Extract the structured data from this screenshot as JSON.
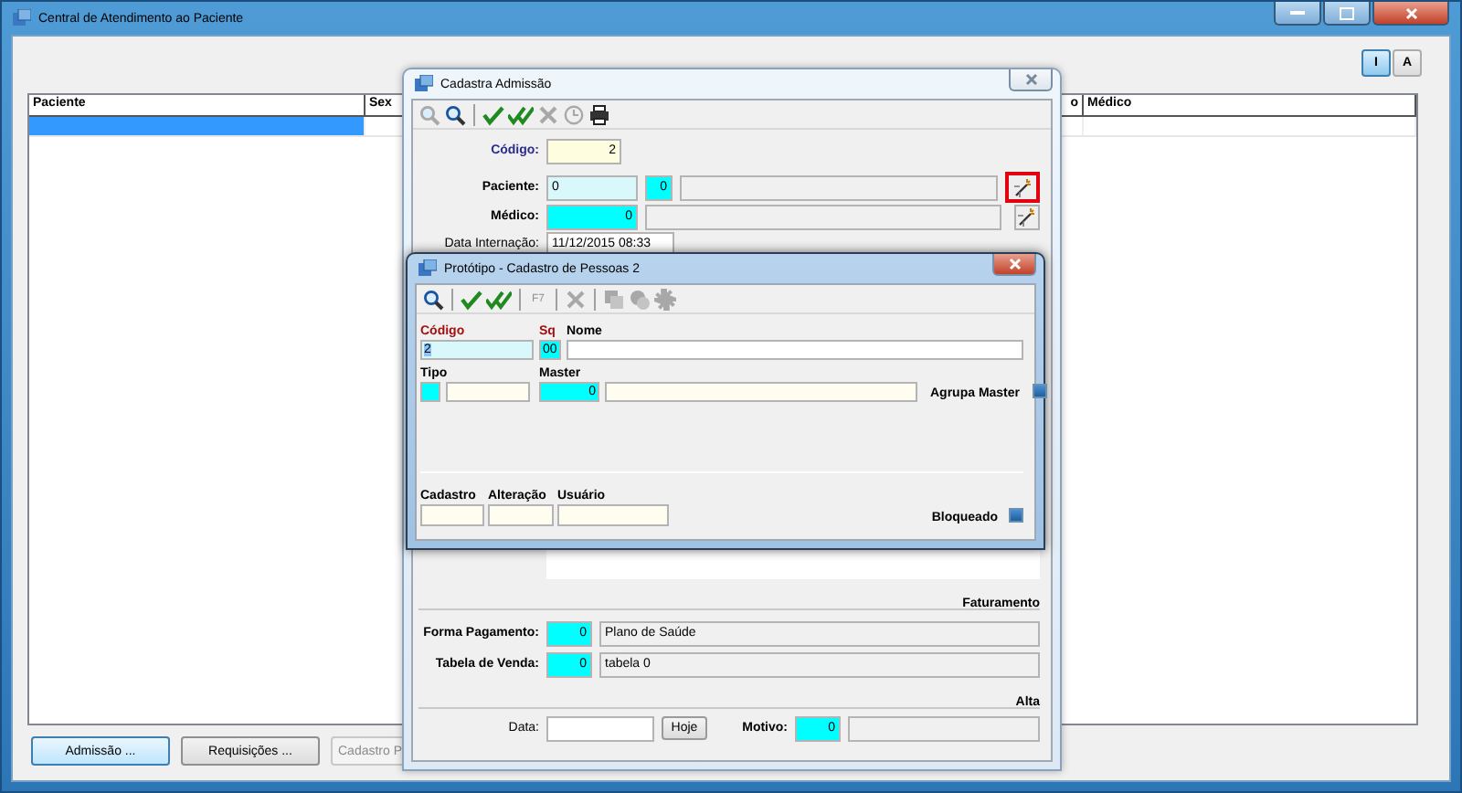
{
  "window": {
    "title": "Central de Atendimento ao Paciente"
  },
  "view_toggle": [
    {
      "label": "I",
      "selected": true
    },
    {
      "label": "A",
      "selected": false
    }
  ],
  "table": {
    "columns": [
      "Paciente",
      "Sex",
      "o",
      "Médico"
    ],
    "rows": [
      {
        "selected": true
      }
    ]
  },
  "buttons": [
    {
      "label": "Admissão ...",
      "focused": true,
      "disabled": false
    },
    {
      "label": "Requisições ...",
      "focused": false,
      "disabled": false
    },
    {
      "label": "Cadastro P",
      "focused": false,
      "disabled": true
    }
  ],
  "admission_dialog": {
    "title": "Cadastra Admissão",
    "toolbar": [
      {
        "kind": "zoom",
        "disabled": true
      },
      {
        "kind": "search",
        "disabled": false
      },
      {
        "kind": "separator"
      },
      {
        "kind": "check",
        "disabled": false
      },
      {
        "kind": "check-all",
        "disabled": false
      },
      {
        "kind": "cancel",
        "disabled": true
      },
      {
        "kind": "history",
        "disabled": true
      },
      {
        "kind": "print",
        "disabled": false
      }
    ],
    "codigo": {
      "label": "Código:",
      "value": "2",
      "emphasis": true
    },
    "paciente": {
      "label": "Paciente:",
      "value": "0",
      "code": "0",
      "lookup_highlighted": true
    },
    "medico": {
      "label": "Médico:",
      "code": "0",
      "lookup_highlighted": false
    },
    "data_internacao": {
      "label": "Data Internação:",
      "value": "11/12/2015 08:33"
    },
    "faturamento": {
      "title": "Faturamento",
      "rows": [
        {
          "label": "Forma Pagamento:",
          "code": "0",
          "name": "Plano de Saúde"
        },
        {
          "label": "Tabela de Venda:",
          "code": "0",
          "name": "tabela 0"
        }
      ]
    },
    "alta": {
      "title": "Alta",
      "date_label": "Data:",
      "today_button": "Hoje",
      "motivo_label": "Motivo:",
      "motivo_code": "0"
    }
  },
  "person_dialog": {
    "title": "Protótipo - Cadastro de Pessoas 2",
    "toolbar": [
      {
        "kind": "search",
        "disabled": false
      },
      {
        "kind": "separator"
      },
      {
        "kind": "check",
        "disabled": false
      },
      {
        "kind": "check-all",
        "disabled": false
      },
      {
        "kind": "separator"
      },
      {
        "kind": "text",
        "label": "F7",
        "disabled": true
      },
      {
        "kind": "separator"
      },
      {
        "kind": "cancel",
        "disabled": true
      },
      {
        "kind": "separator"
      },
      {
        "kind": "copy",
        "disabled": true
      },
      {
        "kind": "group",
        "disabled": true
      },
      {
        "kind": "gear",
        "disabled": true
      }
    ],
    "codigo": {
      "label": "Código",
      "value": "2",
      "required": true,
      "text_selected": true
    },
    "sq": {
      "label": "Sq",
      "value": "00",
      "required": true
    },
    "nome": {
      "label": "Nome",
      "required": false
    },
    "tipo": {
      "label": "Tipo"
    },
    "master": {
      "label": "Master",
      "value": "0"
    },
    "agrupa_master": {
      "label": "Agrupa Master",
      "checked": true
    },
    "cadastro": {
      "label": "Cadastro"
    },
    "alteracao": {
      "label": "Alteração"
    },
    "usuario": {
      "label": "Usuário"
    },
    "bloqueado": {
      "label": "Bloqueado",
      "checked": true
    }
  }
}
